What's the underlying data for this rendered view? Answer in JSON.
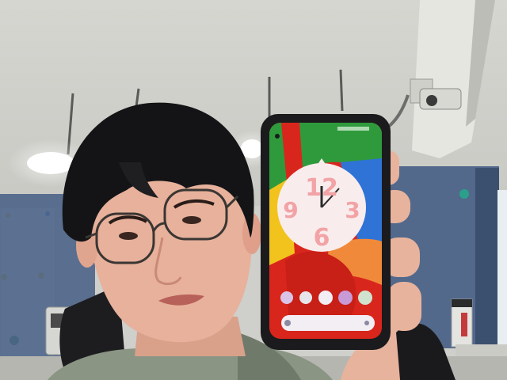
{
  "scene": {
    "colors": {
      "ceiling": "#d9d9d4",
      "partition": "#4f6a8e",
      "skin": "#e9b39d",
      "hair": "#141416",
      "phone_case": "#1b1b1d",
      "wall_red": "#d9261c",
      "wall_green": "#2f9a3c",
      "wall_blue": "#2f73d6",
      "wall_yellow": "#f1c31c",
      "wall_orange": "#f08a3a",
      "clock_face": "#f9ecec",
      "clock_digits": "#f2a3a6"
    }
  },
  "phone": {
    "clock_numerals": [
      "12",
      "3",
      "6",
      "9"
    ]
  }
}
